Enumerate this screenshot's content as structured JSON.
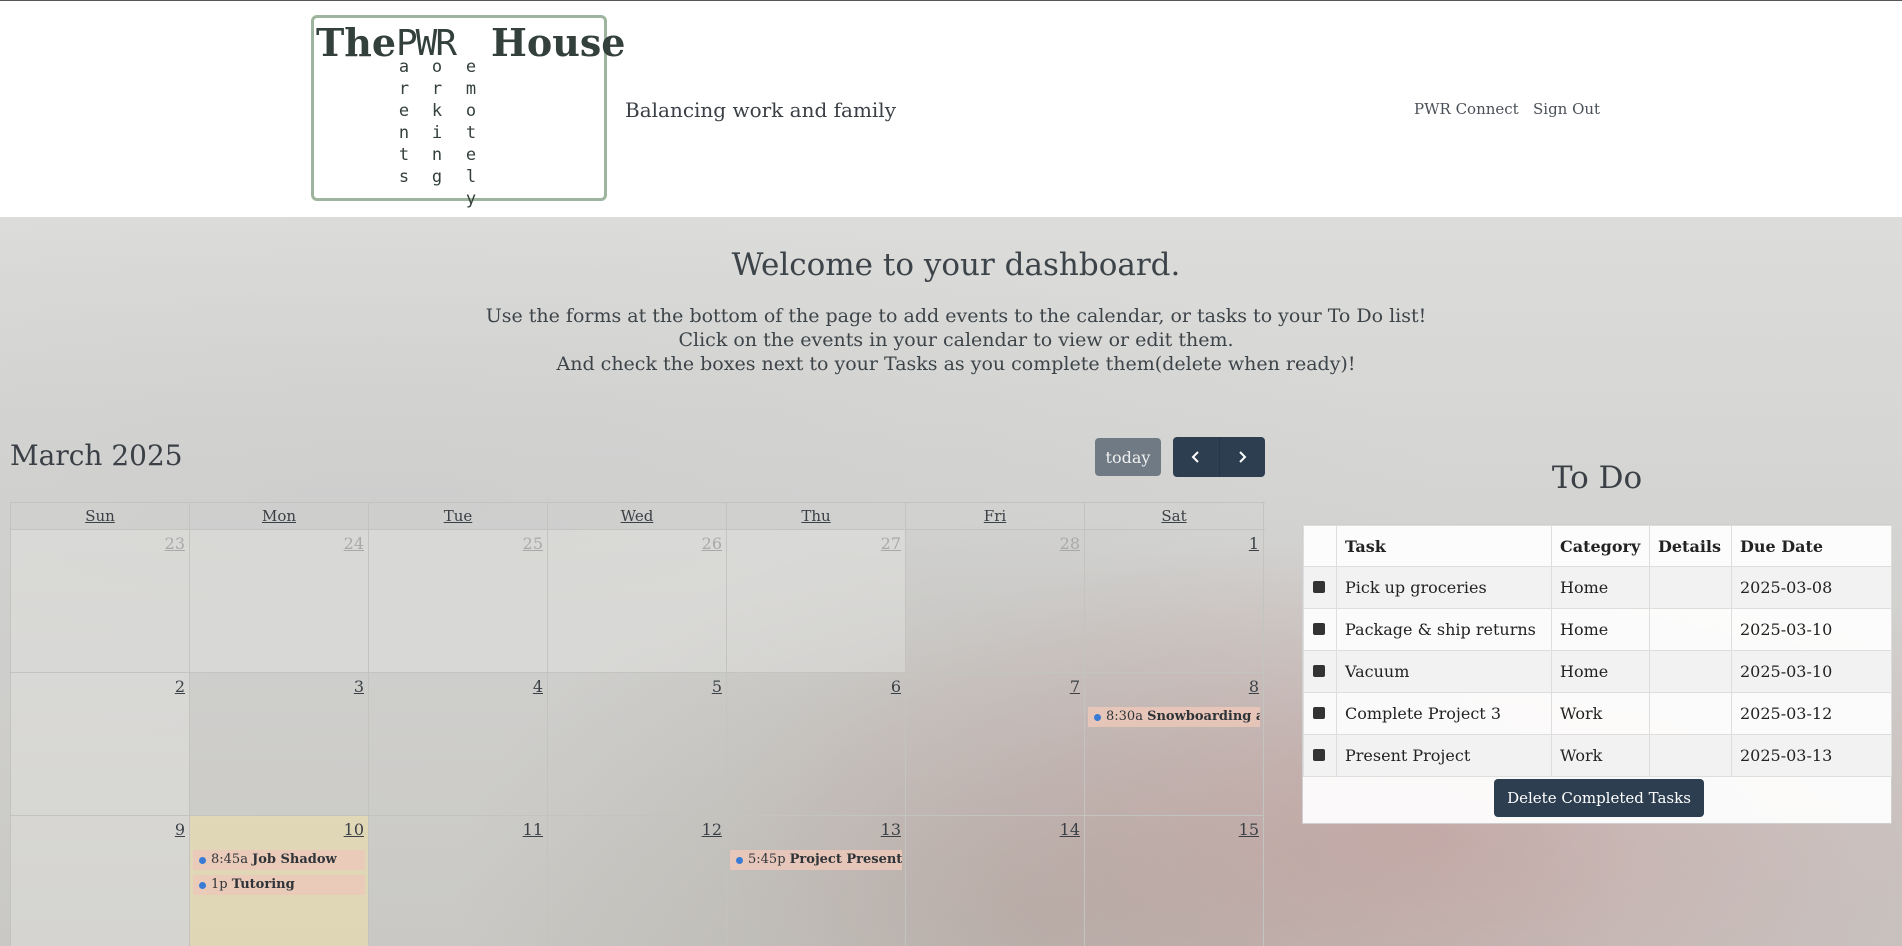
{
  "header": {
    "logo": {
      "the": "The",
      "pwr": "PWR",
      "house": "House",
      "col_p": "a\nr\ne\nn\nt\ns",
      "col_w": "o\nr\nk\ni\nn\ng",
      "col_r": "e\nm\no\nt\ne\nl\ny"
    },
    "tagline": "Balancing work and family",
    "nav": {
      "connect": "PWR Connect",
      "signout": "Sign Out"
    }
  },
  "welcome": {
    "title": "Welcome to your dashboard.",
    "line1": "Use the forms at the bottom of the page to add events to the calendar, or tasks to your To Do list!",
    "line2": "Click on the events in your calendar to view or edit them.",
    "line3": "And check the boxes next to your Tasks as you complete them(delete when ready)!"
  },
  "calendar": {
    "title": "March 2025",
    "today_label": "today",
    "prev_icon": "chevron-left-icon",
    "next_icon": "chevron-right-icon",
    "days": [
      "Sun",
      "Mon",
      "Tue",
      "Wed",
      "Thu",
      "Fri",
      "Sat"
    ],
    "weeks": [
      [
        "23",
        "24",
        "25",
        "26",
        "27",
        "28",
        "1"
      ],
      [
        "2",
        "3",
        "4",
        "5",
        "6",
        "7",
        "8"
      ],
      [
        "9",
        "10",
        "11",
        "12",
        "13",
        "14",
        "15"
      ]
    ],
    "events": {
      "sat8": {
        "time": "8:30a",
        "title": "Snowboarding at"
      },
      "mon10a": {
        "time": "8:45a",
        "title": "Job Shadow"
      },
      "mon10b": {
        "time": "1p",
        "title": "Tutoring"
      },
      "thu13": {
        "time": "5:45p",
        "title": "Project Presentat"
      }
    },
    "event_dot_color": "#3a7bd5",
    "today_color": "#f0e2aa"
  },
  "todo": {
    "title": "To Do",
    "headers": {
      "task": "Task",
      "category": "Category",
      "details": "Details",
      "due": "Due Date"
    },
    "rows": [
      {
        "task": "Pick up groceries",
        "category": "Home",
        "details": "",
        "due": "2025-03-08"
      },
      {
        "task": "Package & ship returns",
        "category": "Home",
        "details": "",
        "due": "2025-03-10"
      },
      {
        "task": "Vacuum",
        "category": "Home",
        "details": "",
        "due": "2025-03-10"
      },
      {
        "task": "Complete Project 3",
        "category": "Work",
        "details": "",
        "due": "2025-03-12"
      },
      {
        "task": "Present Project",
        "category": "Work",
        "details": "",
        "due": "2025-03-13"
      }
    ],
    "delete_label": "Delete Completed Tasks"
  },
  "colors": {
    "primary": "#2c3e50",
    "secondary": "#6f7a84",
    "logo_border": "#9db59f"
  }
}
